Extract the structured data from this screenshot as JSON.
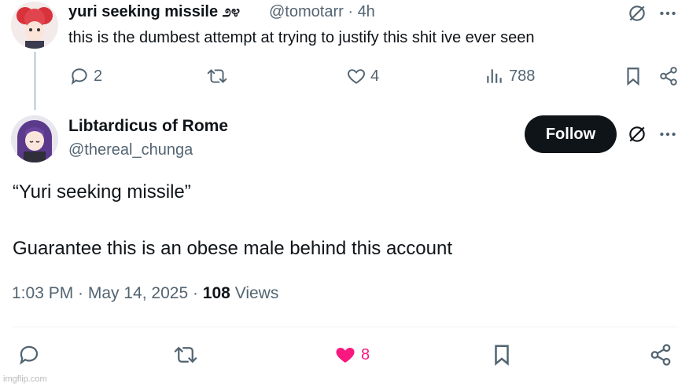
{
  "reply": {
    "name": "yuri seeking missile ೨೪",
    "handle": "@tomotarr",
    "separator": "·",
    "time": "4h",
    "text": "this is the dumbest attempt at trying to justify this shit ive ever seen",
    "counts": {
      "replies": "2",
      "retweets": "",
      "likes": "4",
      "views": "788"
    }
  },
  "main": {
    "name": "Libtardicus of Rome",
    "handle": "@thereal_chunga",
    "follow_label": "Follow",
    "text_line_1": "“Yuri seeking missile”",
    "text_line_2": "Guarantee this is an obese male behind this account",
    "timestamp": "1:03 PM · May 14, 2025 ·",
    "views_count": "108",
    "views_label": "Views",
    "counts": {
      "likes": "8"
    }
  },
  "watermark": "imgflip.com",
  "icons": {
    "reply": "reply-icon",
    "retweet": "retweet-icon",
    "like": "heart-icon",
    "views": "views-icon",
    "bookmark": "bookmark-icon",
    "share": "share-icon",
    "grok": "grok-icon",
    "more": "more-icon"
  },
  "colors": {
    "text": "#0f1419",
    "secondary": "#536471",
    "like": "#f91880",
    "follow_bg": "#0f1419",
    "thread_line": "#cfd9de"
  }
}
